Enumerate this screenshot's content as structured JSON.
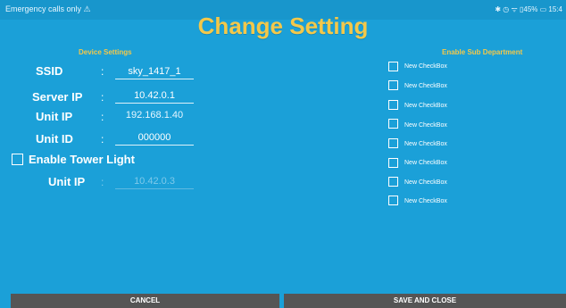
{
  "status_bar": {
    "left_text": "Emergency calls only ⚠",
    "right_text": "✱ ◷ ᯤ ▯45% ▭ 15:4"
  },
  "page": {
    "title": "Change Setting"
  },
  "device_settings": {
    "section_title": "Device Settings",
    "separator": ":",
    "ssid": {
      "label": "SSID",
      "value": "sky_1417_1"
    },
    "server_ip": {
      "label": "Server IP",
      "value": "10.42.0.1"
    },
    "unit_ip": {
      "label": "Unit IP",
      "value": "192.168.1.40"
    },
    "unit_id": {
      "label": "Unit ID",
      "value": "000000"
    },
    "tower_light": {
      "label": "Enable Tower Light",
      "checked": false
    },
    "tower_unit_ip": {
      "label": "Unit IP",
      "value": "10.42.0.3"
    }
  },
  "sub_department": {
    "section_title": "Enable Sub Department",
    "checkboxes": [
      {
        "label": "New CheckBox",
        "checked": false
      },
      {
        "label": "New CheckBox",
        "checked": false
      },
      {
        "label": "New CheckBox",
        "checked": false
      },
      {
        "label": "New CheckBox",
        "checked": false
      },
      {
        "label": "New CheckBox",
        "checked": false
      },
      {
        "label": "New CheckBox",
        "checked": false
      },
      {
        "label": "New CheckBox",
        "checked": false
      },
      {
        "label": "New CheckBox",
        "checked": false
      }
    ]
  },
  "buttons": {
    "cancel": "CANCEL",
    "save": "SAVE AND CLOSE"
  }
}
